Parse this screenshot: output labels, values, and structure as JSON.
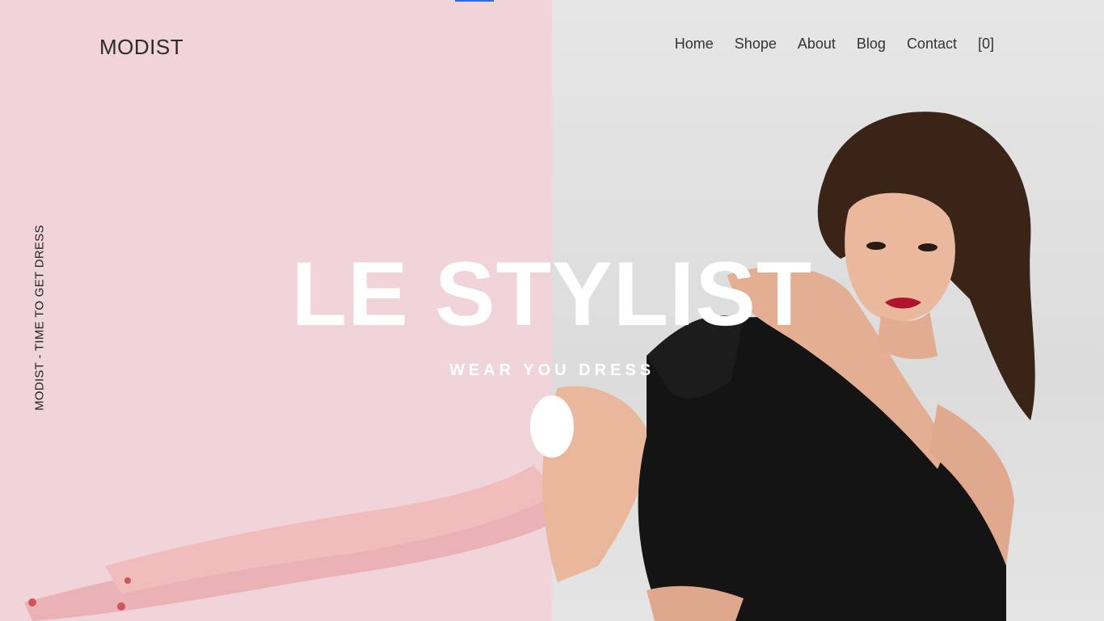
{
  "brand": {
    "logo": "MODIST"
  },
  "nav": {
    "items": [
      {
        "label": "Home"
      },
      {
        "label": "Shope"
      },
      {
        "label": "About"
      },
      {
        "label": "Blog"
      },
      {
        "label": "Contact"
      },
      {
        "label": "[0]"
      }
    ]
  },
  "sidebar": {
    "vertical_text": "MODIST - TIME TO GET DRESS"
  },
  "hero": {
    "title": "LE STYLIST",
    "subtitle": "WEAR YOU DRESS",
    "image": "woman-in-black-lace-dress-photo",
    "colors": {
      "left_panel": "#f1d4d9",
      "right_panel": "#e0e0e0",
      "text": "#ffffff"
    }
  }
}
